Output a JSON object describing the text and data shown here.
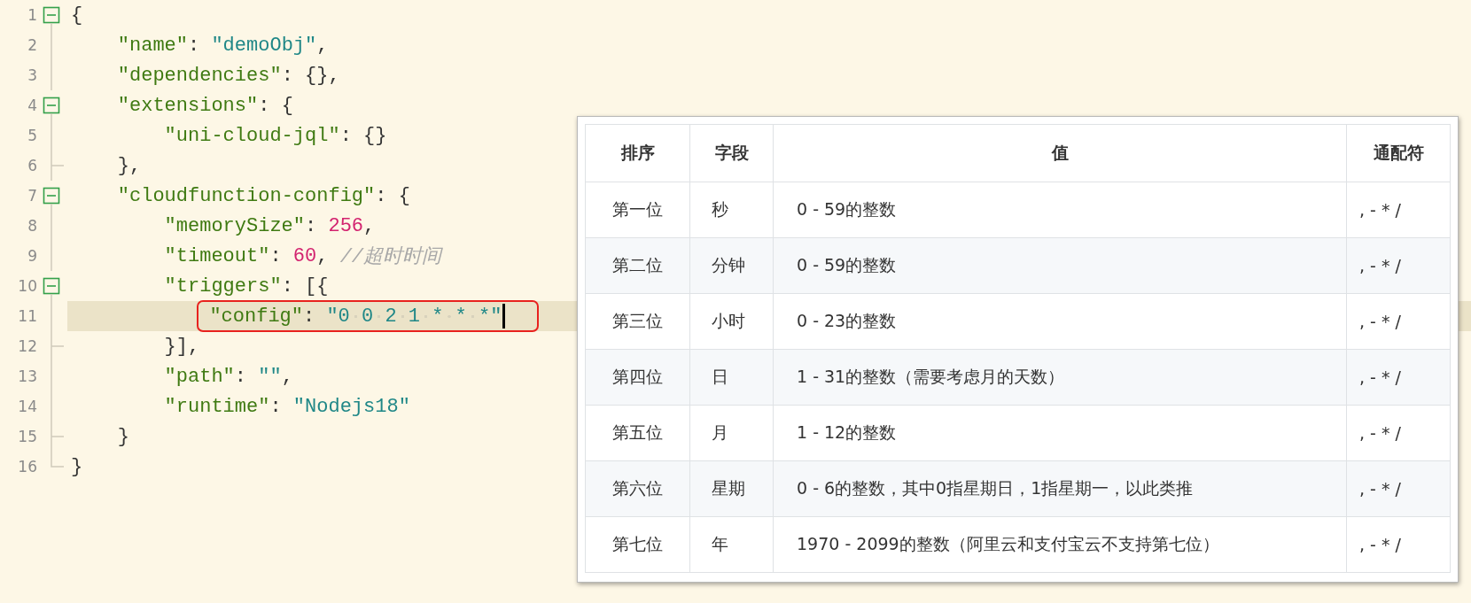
{
  "editor": {
    "lines": [
      {
        "number": "1",
        "expanded": true,
        "highlighted": false,
        "tokens": [
          {
            "kind": "punct",
            "text": "{"
          }
        ],
        "children": [
          {
            "number": "2",
            "highlighted": false,
            "tokens": [
              {
                "kind": "key",
                "text": "\"name\""
              },
              {
                "kind": "punct",
                "text": ": "
              },
              {
                "kind": "string",
                "text": "\"demoObj\""
              },
              {
                "kind": "punct",
                "text": ","
              }
            ]
          },
          {
            "number": "3",
            "highlighted": false,
            "tokens": [
              {
                "kind": "key",
                "text": "\"dependencies\""
              },
              {
                "kind": "punct",
                "text": ": {},"
              }
            ]
          },
          {
            "number": "4",
            "expanded": true,
            "highlighted": false,
            "tokens": [
              {
                "kind": "key",
                "text": "\"extensions\""
              },
              {
                "kind": "punct",
                "text": ": {"
              }
            ],
            "children": [
              {
                "number": "5",
                "highlighted": false,
                "tokens": [
                  {
                    "kind": "key",
                    "text": "\"uni-cloud-jql\""
                  },
                  {
                    "kind": "punct",
                    "text": ": {}"
                  }
                ]
              }
            ]
          },
          {
            "number": "6",
            "highlighted": false,
            "tokens": [
              {
                "kind": "punct",
                "text": "},"
              }
            ]
          },
          {
            "number": "7",
            "expanded": true,
            "highlighted": false,
            "tokens": [
              {
                "kind": "key",
                "text": "\"cloudfunction-config\""
              },
              {
                "kind": "punct",
                "text": ": {"
              }
            ],
            "children": [
              {
                "number": "8",
                "highlighted": false,
                "tokens": [
                  {
                    "kind": "key",
                    "text": "\"memorySize\""
                  },
                  {
                    "kind": "punct",
                    "text": ": "
                  },
                  {
                    "kind": "number",
                    "text": "256"
                  },
                  {
                    "kind": "punct",
                    "text": ","
                  }
                ]
              },
              {
                "number": "9",
                "highlighted": false,
                "tokens": [
                  {
                    "kind": "key",
                    "text": "\"timeout\""
                  },
                  {
                    "kind": "punct",
                    "text": ": "
                  },
                  {
                    "kind": "number",
                    "text": "60"
                  },
                  {
                    "kind": "punct",
                    "text": ", "
                  },
                  {
                    "kind": "comment",
                    "text": "//超时时间"
                  }
                ]
              },
              {
                "number": "10",
                "expanded": true,
                "highlighted": false,
                "tokens": [
                  {
                    "kind": "key",
                    "text": "\"triggers\""
                  },
                  {
                    "kind": "punct",
                    "text": ": [{"
                  }
                ],
                "children": [
                  {
                    "number": "11",
                    "highlighted": true,
                    "boxed": true,
                    "cursor": true,
                    "tokens": [
                      {
                        "kind": "key",
                        "text": "\"config\""
                      },
                      {
                        "kind": "punct",
                        "text": ": "
                      },
                      {
                        "kind": "string",
                        "text": "\"0 0 2 1 * * *\""
                      }
                    ]
                  }
                ]
              },
              {
                "number": "12",
                "highlighted": false,
                "tokens": [
                  {
                    "kind": "punct",
                    "text": "}],"
                  }
                ]
              },
              {
                "number": "13",
                "highlighted": false,
                "tokens": [
                  {
                    "kind": "key",
                    "text": "\"path\""
                  },
                  {
                    "kind": "punct",
                    "text": ": "
                  },
                  {
                    "kind": "string",
                    "text": "\"\""
                  },
                  {
                    "kind": "punct",
                    "text": ","
                  }
                ]
              },
              {
                "number": "14",
                "highlighted": false,
                "tokens": [
                  {
                    "kind": "key",
                    "text": "\"runtime\""
                  },
                  {
                    "kind": "punct",
                    "text": ": "
                  },
                  {
                    "kind": "string",
                    "text": "\"Nodejs18\""
                  }
                ]
              }
            ]
          },
          {
            "number": "15",
            "highlighted": false,
            "tokens": [
              {
                "kind": "punct",
                "text": "}"
              }
            ]
          }
        ]
      },
      {
        "number": "16",
        "highlighted": false,
        "tokens": [
          {
            "kind": "punct",
            "text": "}"
          }
        ]
      }
    ]
  },
  "table": {
    "columns": [
      "排序",
      "字段",
      "值",
      "通配符"
    ],
    "rows": [
      [
        "第一位",
        "秒",
        "0 - 59的整数",
        ", - * /"
      ],
      [
        "第二位",
        "分钟",
        "0 - 59的整数",
        ", - * /"
      ],
      [
        "第三位",
        "小时",
        "0 - 23的整数",
        ", - * /"
      ],
      [
        "第四位",
        "日",
        "1 - 31的整数（需要考虑月的天数）",
        ", - * /"
      ],
      [
        "第五位",
        "月",
        "1 - 12的整数",
        ", - * /"
      ],
      [
        "第六位",
        "星期",
        "0 - 6的整数，其中0指星期日，1指星期一，以此类推",
        ", - * /"
      ],
      [
        "第七位",
        "年",
        "1970 - 2099的整数（阿里云和支付宝云不支持第七位）",
        ", - * /"
      ]
    ]
  }
}
